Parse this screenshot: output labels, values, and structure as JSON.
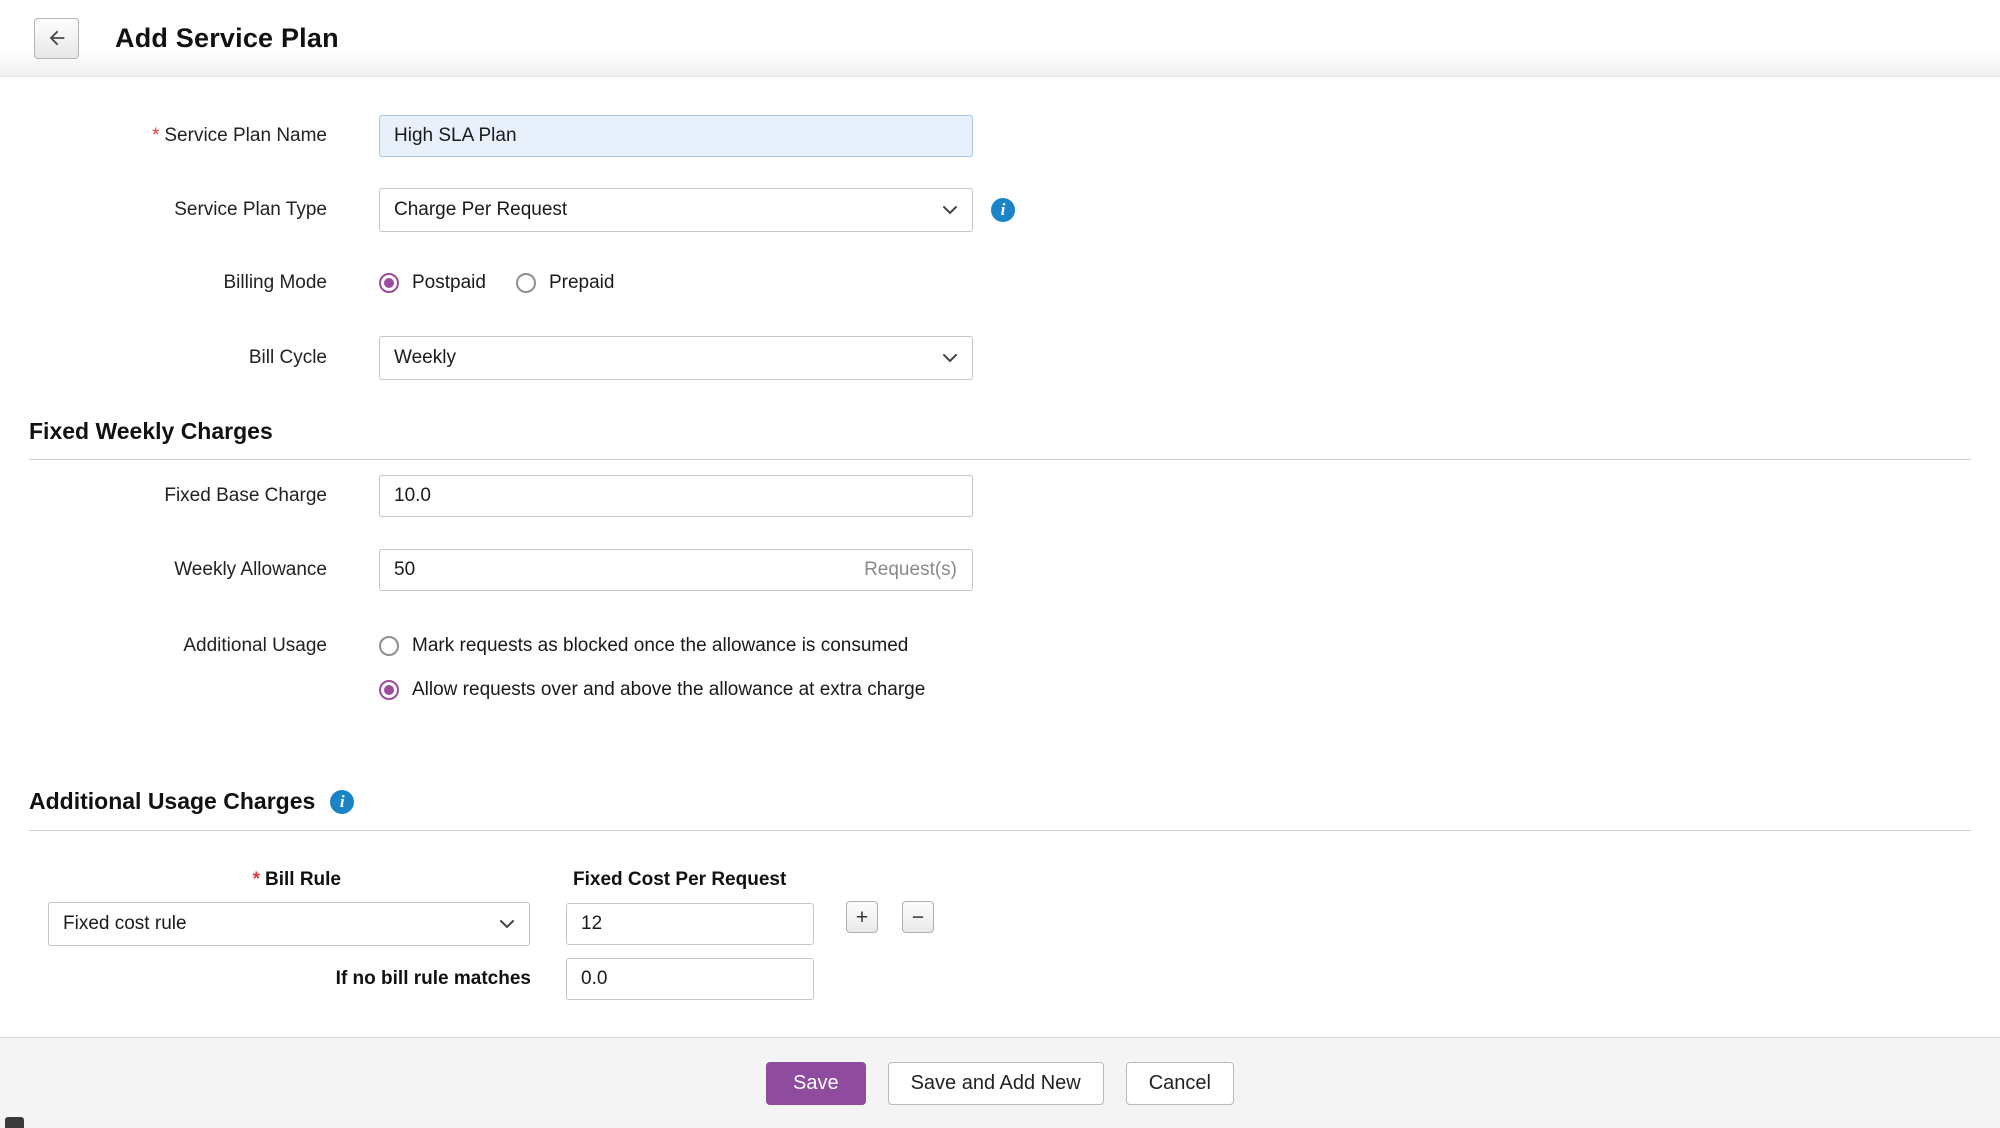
{
  "ui": {
    "required_marker": "*",
    "info_glyph": "i"
  },
  "header": {
    "title": "Add Service Plan"
  },
  "form": {
    "service_plan_name": {
      "label": "Service Plan Name",
      "value": "High SLA Plan"
    },
    "service_plan_type": {
      "label": "Service Plan Type",
      "value": "Charge Per Request"
    },
    "billing_mode": {
      "label": "Billing Mode",
      "options": [
        {
          "label": "Postpaid",
          "selected": true
        },
        {
          "label": "Prepaid",
          "selected": false
        }
      ]
    },
    "bill_cycle": {
      "label": "Bill Cycle",
      "value": "Weekly"
    }
  },
  "fixed_weekly_charges": {
    "heading": "Fixed Weekly Charges",
    "fixed_base_charge": {
      "label": "Fixed Base Charge",
      "value": "10.0"
    },
    "weekly_allowance": {
      "label": "Weekly Allowance",
      "value": "50",
      "unit": "Request(s)"
    },
    "additional_usage": {
      "label": "Additional Usage",
      "options": [
        {
          "label": "Mark requests as blocked once the allowance is consumed",
          "selected": false
        },
        {
          "label": "Allow requests over and above the allowance at extra charge",
          "selected": true
        }
      ]
    }
  },
  "additional_usage_charges": {
    "heading": "Additional Usage Charges",
    "bill_rule": {
      "label": "Bill Rule",
      "value": "Fixed cost rule"
    },
    "fixed_cost_per_request": {
      "label": "Fixed Cost Per Request",
      "value": "12"
    },
    "no_rule_match": {
      "label": "If no bill rule matches",
      "value": "0.0"
    },
    "add_label": "+",
    "remove_label": "−"
  },
  "footer": {
    "save": "Save",
    "save_and_add_new": "Save and Add New",
    "cancel": "Cancel"
  },
  "colors": {
    "accent_purple": "#8f4b9d",
    "radio_purple": "#9c4b9e",
    "info_blue": "#1a84c7",
    "required_red": "#e03a3a",
    "focused_input_bg": "#e7f0fb"
  }
}
